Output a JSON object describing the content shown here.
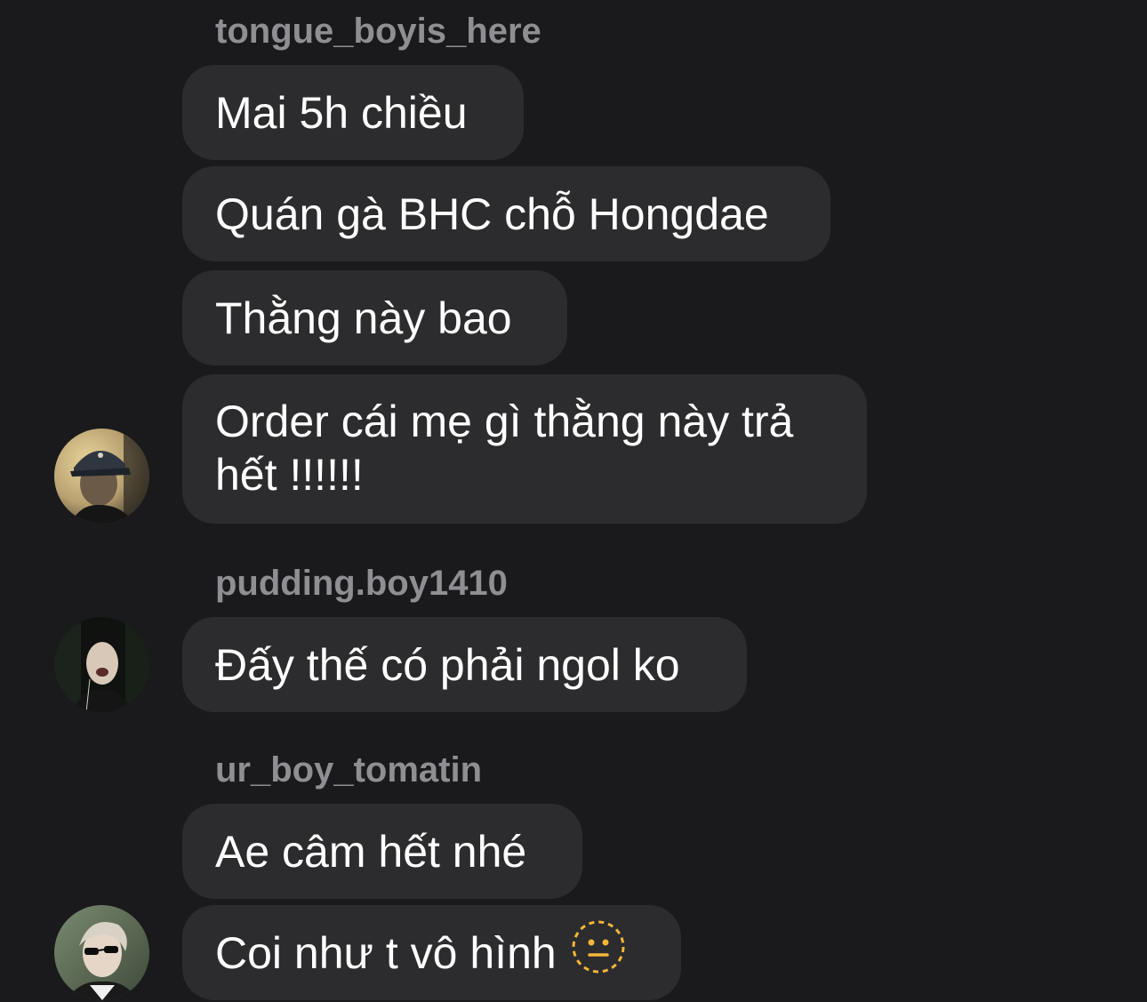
{
  "groups": [
    {
      "sender": "tongue_boyis_here",
      "avatar": "avatar-photo-cap",
      "messages": [
        "Mai 5h chiều",
        "Quán gà BHC chỗ Hongdae",
        "Thằng này bao",
        "Order cái mẹ gì thằng này trả hết !!!!!!"
      ]
    },
    {
      "sender": "pudding.boy1410",
      "avatar": "avatar-photo-beanie",
      "messages": [
        "Đấy thế có phải ngol ko"
      ]
    },
    {
      "sender": "ur_boy_tomatin",
      "avatar": "avatar-photo-sunglasses",
      "messages": [
        "Ae câm hết nhé",
        "Coi như t vô hình"
      ],
      "emoji": "dotted-line-neutral-face-icon"
    }
  ],
  "colors": {
    "background": "#1a1a1c",
    "bubble": "#2c2c2e",
    "sender_name": "#8e8e93",
    "message_text": "#ffffff"
  }
}
